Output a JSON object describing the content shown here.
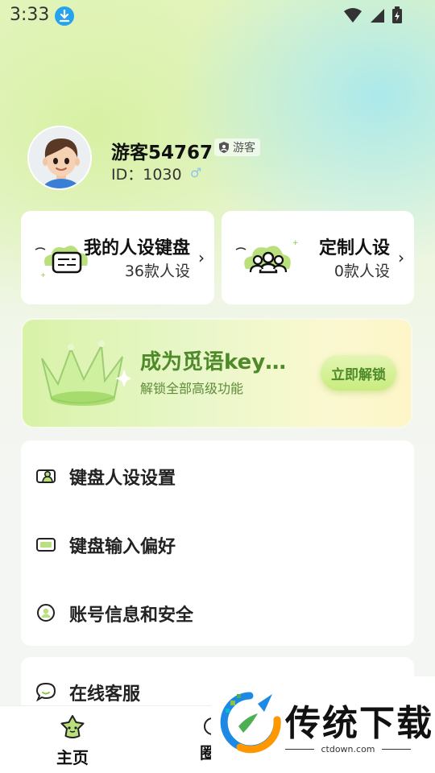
{
  "status_bar": {
    "time": "3:33"
  },
  "profile": {
    "username": "游客54767",
    "guest_tag": "游客",
    "id_text": "ID：1030",
    "gender_icon": "male-icon"
  },
  "cards": [
    {
      "title": "我的人设键盘",
      "subtitle": "36款人设"
    },
    {
      "title": "定制人设",
      "subtitle": "0款人设"
    }
  ],
  "vip": {
    "title": "成为觅语key…",
    "subtitle": "解锁全部高级功能",
    "button": "立即解锁"
  },
  "menu": [
    {
      "label": "键盘人设设置",
      "icon": "persona-card-icon"
    },
    {
      "label": "键盘输入偏好",
      "icon": "keyboard-icon"
    },
    {
      "label": "账号信息和安全",
      "icon": "account-icon"
    }
  ],
  "menu2": [
    {
      "label": "在线客服",
      "icon": "chat-bubble-icon"
    }
  ],
  "bottom_nav": {
    "home_label": "主页",
    "second_label": "圈"
  },
  "watermark": {
    "text": "传统下载",
    "url": "ctdown.com"
  },
  "colors": {
    "accent_green": "#4f8a2a",
    "badge_blue": "#27a3ee"
  }
}
